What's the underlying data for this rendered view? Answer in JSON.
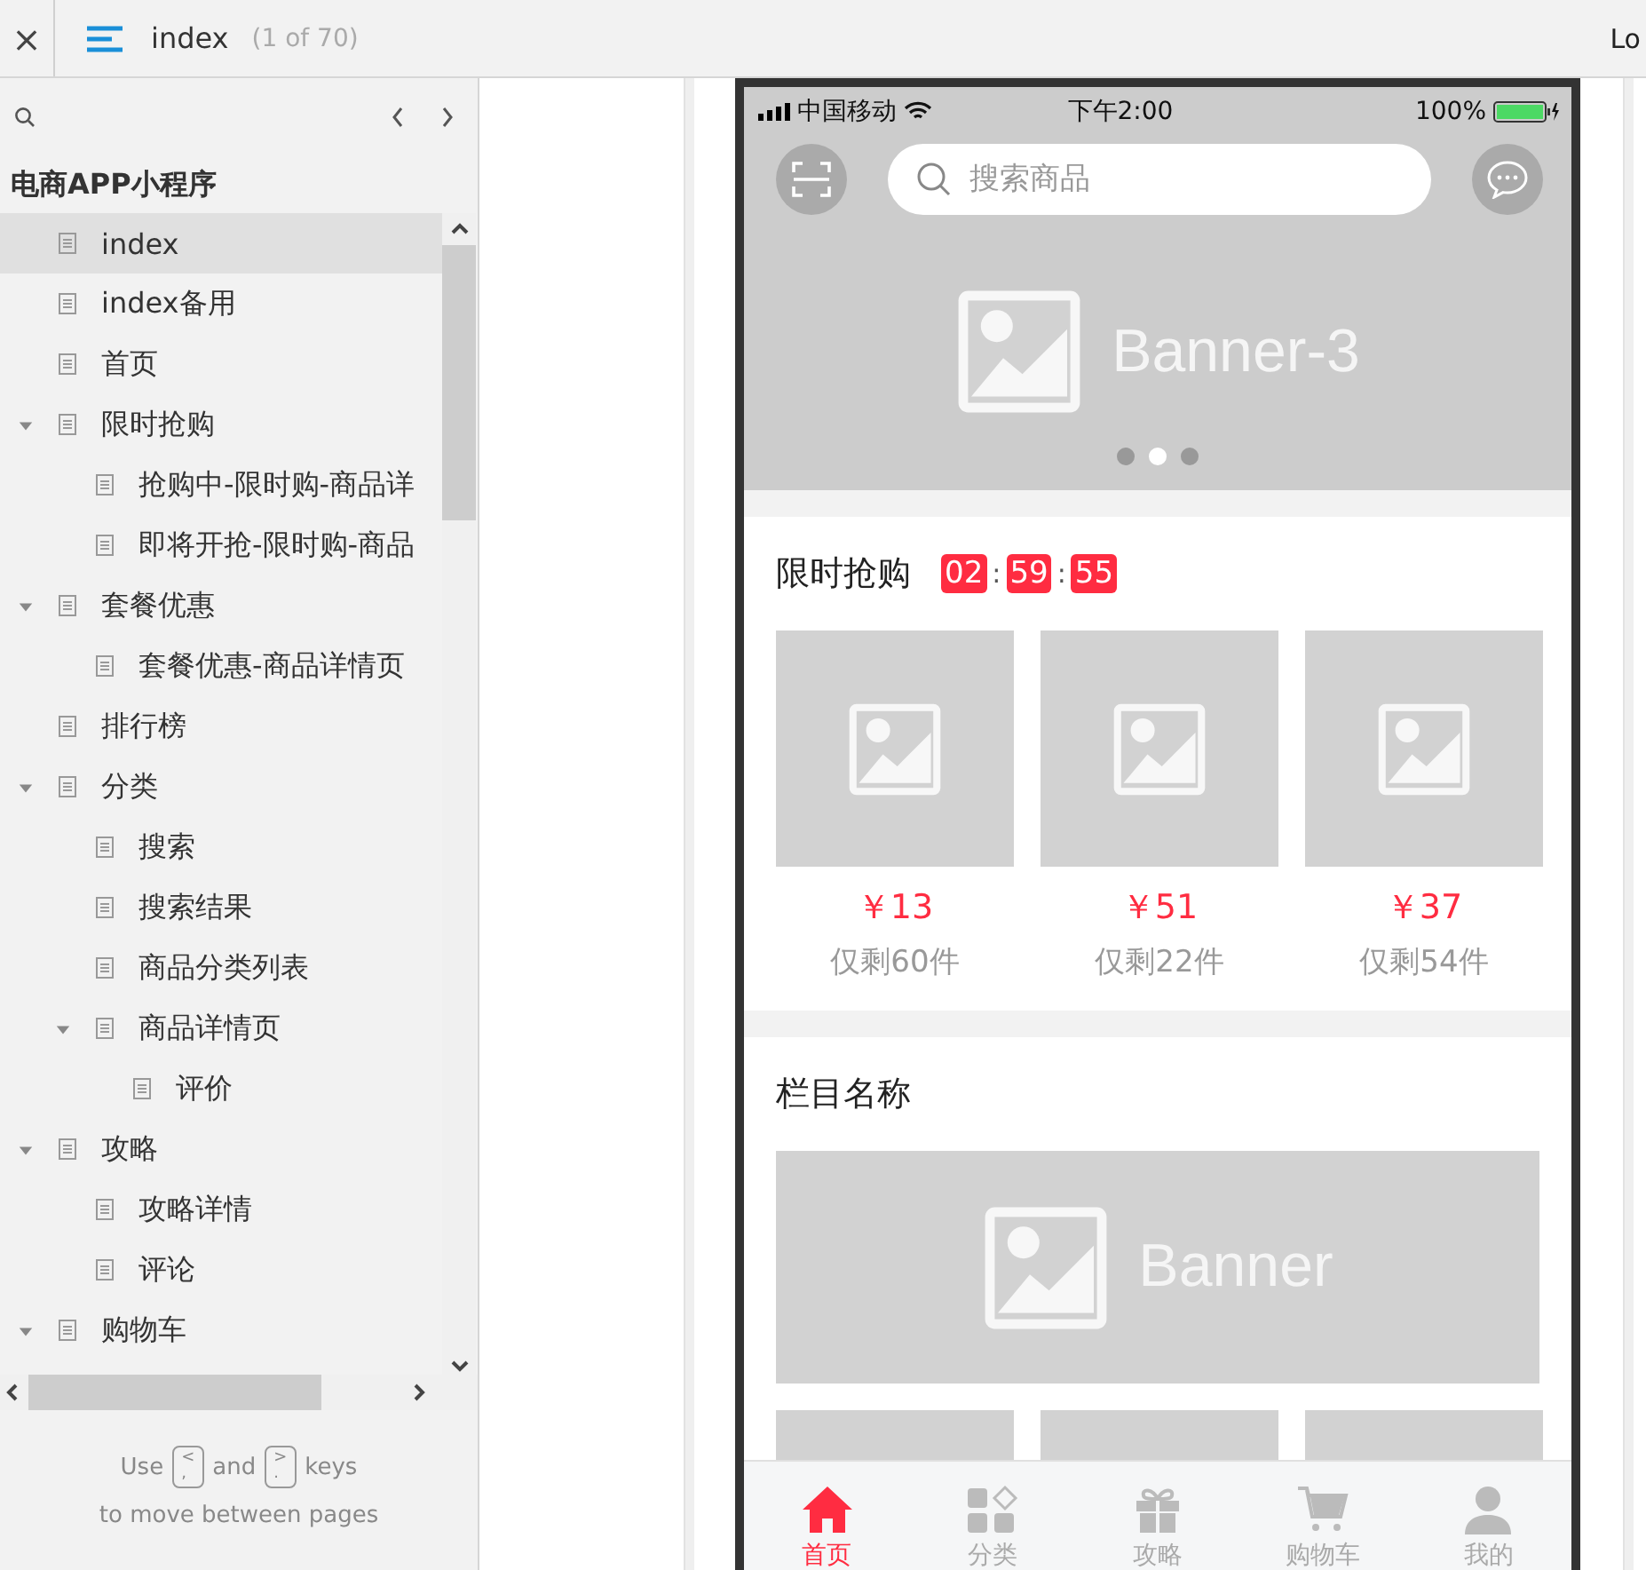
{
  "toolbar": {
    "close": "×",
    "page_title": "index",
    "page_count": "(1 of 70)",
    "right_text": "Lo"
  },
  "sidebar": {
    "project": "电商APP小程序",
    "tree": [
      {
        "label": "index",
        "selected": true
      },
      {
        "label": "index备用",
        "selected": false
      },
      {
        "label": "首页",
        "selected": false
      },
      {
        "label": "限时抢购",
        "selected": false,
        "expanded": true,
        "children": [
          {
            "label": "抢购中-限时购-商品详",
            "selected": false
          },
          {
            "label": "即将开抢-限时购-商品",
            "selected": false
          }
        ]
      },
      {
        "label": "套餐优惠",
        "selected": false,
        "expanded": true,
        "children": [
          {
            "label": "套餐优惠-商品详情页",
            "selected": false
          }
        ]
      },
      {
        "label": "排行榜",
        "selected": false
      },
      {
        "label": "分类",
        "selected": false,
        "expanded": true,
        "children": [
          {
            "label": "搜索",
            "selected": false
          },
          {
            "label": "搜索结果",
            "selected": false
          },
          {
            "label": "商品分类列表",
            "selected": false
          },
          {
            "label": "商品详情页",
            "selected": false,
            "expanded": true,
            "children": [
              {
                "label": "评价",
                "selected": false
              }
            ]
          }
        ]
      },
      {
        "label": "攻略",
        "selected": false,
        "expanded": true,
        "children": [
          {
            "label": "攻略详情",
            "selected": false
          },
          {
            "label": "评论",
            "selected": false
          }
        ]
      },
      {
        "label": "购物车",
        "selected": false,
        "expanded": true
      }
    ],
    "hint": {
      "use": "Use",
      "key_prev": "<\n,",
      "and": "and",
      "key_next": ">\n.",
      "keys": "keys",
      "line2": "to move between pages"
    }
  },
  "phone": {
    "status": {
      "carrier": "中国移动",
      "time": "下午2:00",
      "battery": "100%"
    },
    "search_placeholder": "搜索商品",
    "banner": {
      "label": "Banner-3",
      "dots": [
        {
          "selected": false
        },
        {
          "selected": true
        },
        {
          "selected": false
        }
      ]
    },
    "flash_sale": {
      "title": "限时抢购",
      "timer": [
        "02",
        "59",
        "55"
      ],
      "separator": ":",
      "products": [
        {
          "price": "￥13",
          "stock": "仅剩60件"
        },
        {
          "price": "￥51",
          "stock": "仅剩22件"
        },
        {
          "price": "￥37",
          "stock": "仅剩54件"
        }
      ]
    },
    "section": {
      "title": "栏目名称",
      "banner_label": "Banner"
    },
    "tabbar": [
      {
        "kind": "home",
        "label": "首页",
        "selected": true
      },
      {
        "kind": "category",
        "label": "分类",
        "selected": false
      },
      {
        "kind": "gift",
        "label": "攻略",
        "selected": false
      },
      {
        "kind": "cart",
        "label": "购物车",
        "selected": false
      },
      {
        "kind": "user",
        "label": "我的",
        "selected": false
      }
    ]
  }
}
